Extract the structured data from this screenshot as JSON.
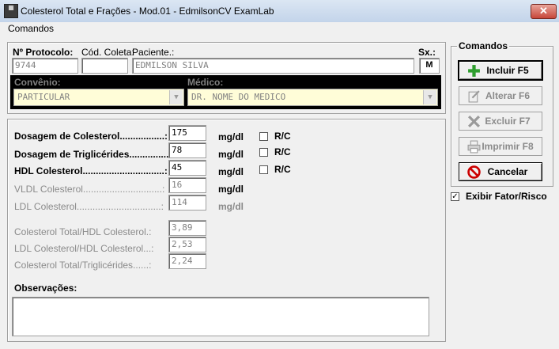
{
  "window": {
    "title": "Colesterol Total e Frações - Mod.01 - EdmilsonCV ExamLab",
    "close": "✕"
  },
  "menu": {
    "comandos": "Comandos"
  },
  "header": {
    "protocolo_label": "Nº Protocolo:",
    "protocolo_value": "9744",
    "cod_coleta_label": "Cód. Coleta:",
    "cod_coleta_value": "",
    "paciente_label": "Paciente.:",
    "paciente_value": "EDMILSON SILVA",
    "sx_label": "Sx.:",
    "sx_value": "M",
    "convenio_label": "Convênio:",
    "convenio_value": "PARTICULAR",
    "medico_label": "Médico:",
    "medico_value": "DR. NOME DO MEDICO"
  },
  "exams": [
    {
      "label": "Dosagem de Colesterol.................:",
      "value": "175",
      "unit": "mg/dl",
      "rc": "R/C"
    },
    {
      "label": "Dosagem de Triglicérides...............:",
      "value": "78",
      "unit": "mg/dl",
      "rc": "R/C"
    },
    {
      "label": "HDL Colesterol...............................:",
      "value": "45",
      "unit": "mg/dl",
      "rc": "R/C"
    },
    {
      "label": "VLDL Colesterol..............................:",
      "value": "16",
      "unit": "mg/dl"
    },
    {
      "label": "LDL Colesterol................................:",
      "value": "114",
      "unit": "mg/dl"
    }
  ],
  "ratios": [
    {
      "label": "Colesterol Total/HDL Colesterol.:",
      "value": "3,89"
    },
    {
      "label": "LDL Colesterol/HDL Colesterol...:",
      "value": "2,53"
    },
    {
      "label": "Colesterol Total/Triglicérides......:",
      "value": "2,24"
    }
  ],
  "observacoes_label": "Observações:",
  "commands": {
    "title": "Comandos",
    "incluir": "Incluir  F5",
    "alterar": "Alterar  F6",
    "excluir": "Excluir  F7",
    "imprimir": "Imprimir F8",
    "cancelar": "Cancelar"
  },
  "fator_risco": {
    "label": "Exibir Fator/Risco",
    "checked": true
  },
  "colors": {
    "active_green": "#2e9e2e",
    "cancel_red": "#cc0000",
    "combo_bg": "#fffdd8"
  }
}
